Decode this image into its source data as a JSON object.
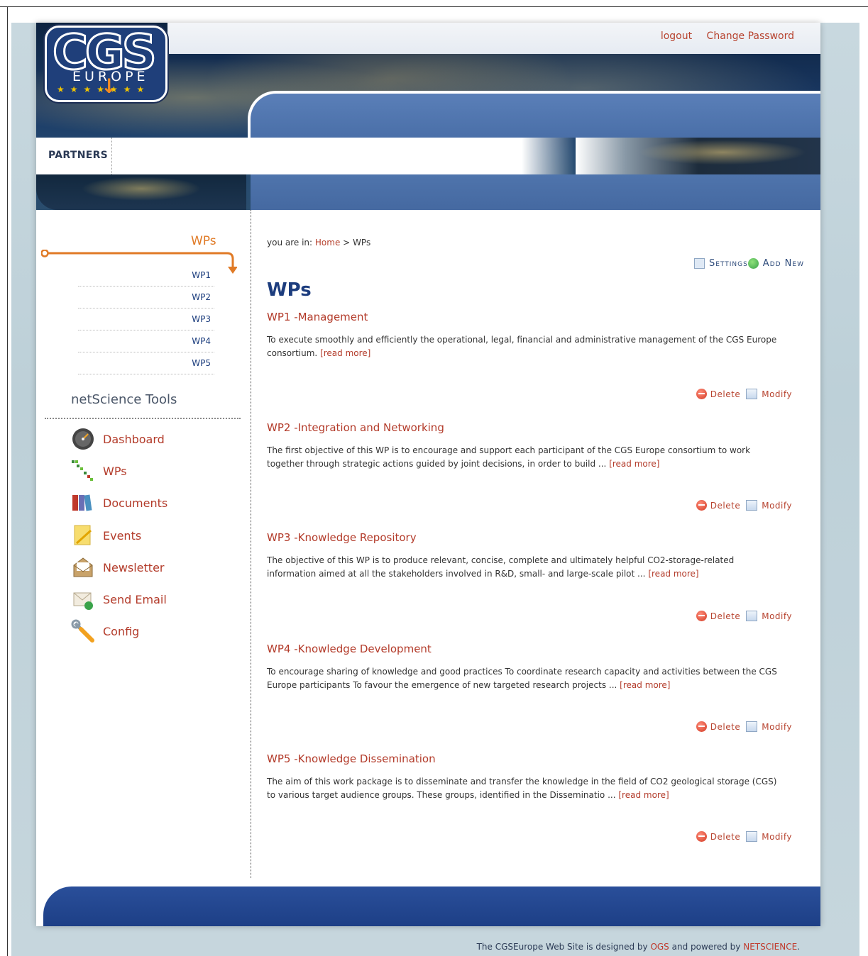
{
  "header": {
    "logo_text": "CGS",
    "logo_sub": "EUROPE",
    "logout": "logout",
    "change_password": "Change Password",
    "nav_partners": "PARTNERS"
  },
  "sidebar": {
    "wps_title": "WPs",
    "wp_items": [
      {
        "label": "WP1"
      },
      {
        "label": "WP2"
      },
      {
        "label": "WP3"
      },
      {
        "label": "WP4"
      },
      {
        "label": "WP5"
      }
    ],
    "tools_title": "netScience Tools",
    "tools": [
      {
        "label": "Dashboard",
        "icon": "dashboard-icon"
      },
      {
        "label": "WPs",
        "icon": "wps-icon"
      },
      {
        "label": "Documents",
        "icon": "documents-icon"
      },
      {
        "label": "Events",
        "icon": "events-icon"
      },
      {
        "label": "Newsletter",
        "icon": "newsletter-icon"
      },
      {
        "label": "Send Email",
        "icon": "send-email-icon"
      },
      {
        "label": "Config",
        "icon": "config-icon"
      }
    ]
  },
  "main": {
    "breadcrumb_prefix": "you are in:",
    "breadcrumb_home": "Home",
    "breadcrumb_sep": ">",
    "breadcrumb_current": "WPs",
    "settings_label": "Settings",
    "add_new_label": "Add New",
    "heading": "WPs",
    "delete_label": "Delete",
    "modify_label": "Modify",
    "read_more": "[read more]",
    "items": [
      {
        "title": "WP1 -Management",
        "desc": "To execute smoothly and efficiently the operational, legal, financial and administrative management of the CGS Europe consortium."
      },
      {
        "title": "WP2 -Integration and Networking",
        "desc": "The first objective of this WP is to encourage and support each participant of the CGS Europe consortium to work together through strategic actions guided by joint decisions, in order to build ..."
      },
      {
        "title": "WP3 -Knowledge Repository",
        "desc": "The objective of this WP is to produce relevant, concise, complete and ultimately helpful CO2-storage-related information aimed at all the stakeholders involved in R&D, small- and large-scale pilot ..."
      },
      {
        "title": "WP4 -Knowledge Development",
        "desc": "To encourage sharing of knowledge and good practices To coordinate research capacity and activities between the CGS Europe participants To favour the emergence of new targeted research projects ..."
      },
      {
        "title": "WP5 -Knowledge Dissemination",
        "desc": "The aim of this work package is to disseminate and transfer the knowledge in the field of CO2 geological storage (CGS) to various target audience groups. These groups, identified in the Disseminatio ..."
      }
    ]
  },
  "footer": {
    "credit_prefix": "The CGSEurope Web Site is designed by",
    "designer": "OGS",
    "credit_mid": "and powered by",
    "powered_by": "NETSCIENCE",
    "credit_suffix": "."
  },
  "colors": {
    "accent_red": "#b33b2a",
    "accent_orange": "#e07a26",
    "brand_blue": "#1d3d7e"
  }
}
